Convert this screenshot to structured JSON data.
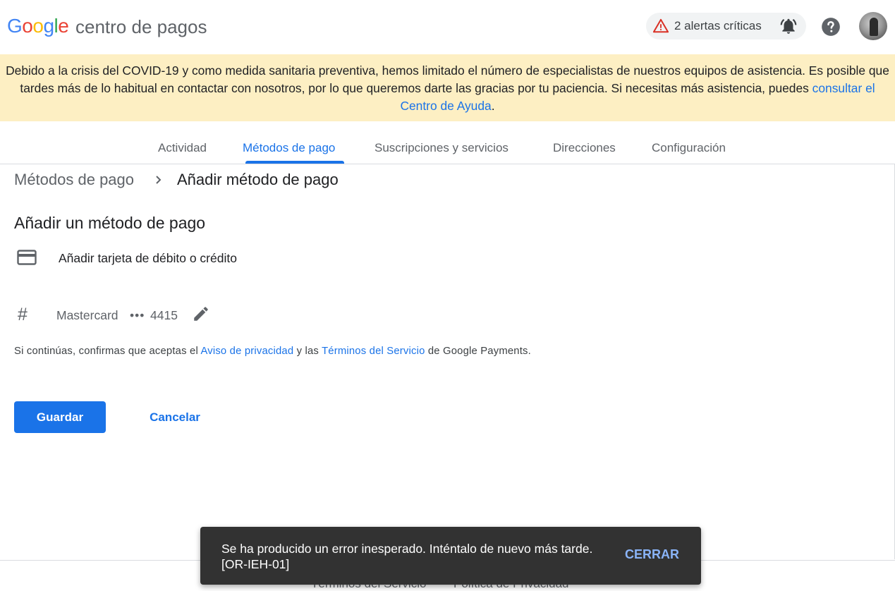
{
  "header": {
    "logo": [
      "G",
      "o",
      "o",
      "g",
      "l",
      "e"
    ],
    "product": "centro de pagos",
    "alerts_label": "2 alertas críticas",
    "icons": {
      "alert": "warning-triangle-icon",
      "bell": "bell-ringing-icon",
      "help": "help-circle-icon",
      "avatar": "user-avatar"
    }
  },
  "banner": {
    "text": "Debido a la crisis del COVID-19 y como medida sanitaria preventiva, hemos limitado el número de especialistas de nuestros equipos de asistencia. Es posible que tardes más de lo habitual en contactar con nosotros, por lo que queremos darte las gracias por tu paciencia. Si necesitas más asistencia, puedes ",
    "link": "consultar el Centro de Ayuda",
    "end": "."
  },
  "tabs": [
    {
      "label": "Actividad",
      "active": false
    },
    {
      "label": "Métodos de pago",
      "active": true
    },
    {
      "label": "Suscripciones y servicios",
      "active": false
    },
    {
      "label": "Direcciones",
      "active": false
    },
    {
      "label": "Configuración",
      "active": false
    }
  ],
  "breadcrumb": {
    "parent": "Métodos de pago",
    "current": "Añadir método de pago"
  },
  "section_title": "Añadir un método de pago",
  "add_card_label": "Añadir tarjeta de débito o crédito",
  "card": {
    "brand": "Mastercard",
    "dots": "•••",
    "last4": "4415"
  },
  "terms": {
    "prefix": "Si continúas, confirmas que aceptas el ",
    "privacy_link": "Aviso de privacidad",
    "middle": " y las ",
    "tos_link": "Términos del Servicio",
    "suffix": " de Google Payments."
  },
  "buttons": {
    "save": "Guardar",
    "cancel": "Cancelar"
  },
  "footer": {
    "tos": "Términos del Servicio",
    "privacy": "Política de Privacidad"
  },
  "snackbar": {
    "line1": "Se ha producido un error inesperado. Inténtalo de nuevo más tarde.",
    "line2": "[OR-IEH-01]",
    "action": "CERRAR"
  },
  "colors": {
    "accent": "#1a73e8",
    "banner": "#fdefc3",
    "snackbar": "#323232",
    "warning": "#d93025"
  }
}
